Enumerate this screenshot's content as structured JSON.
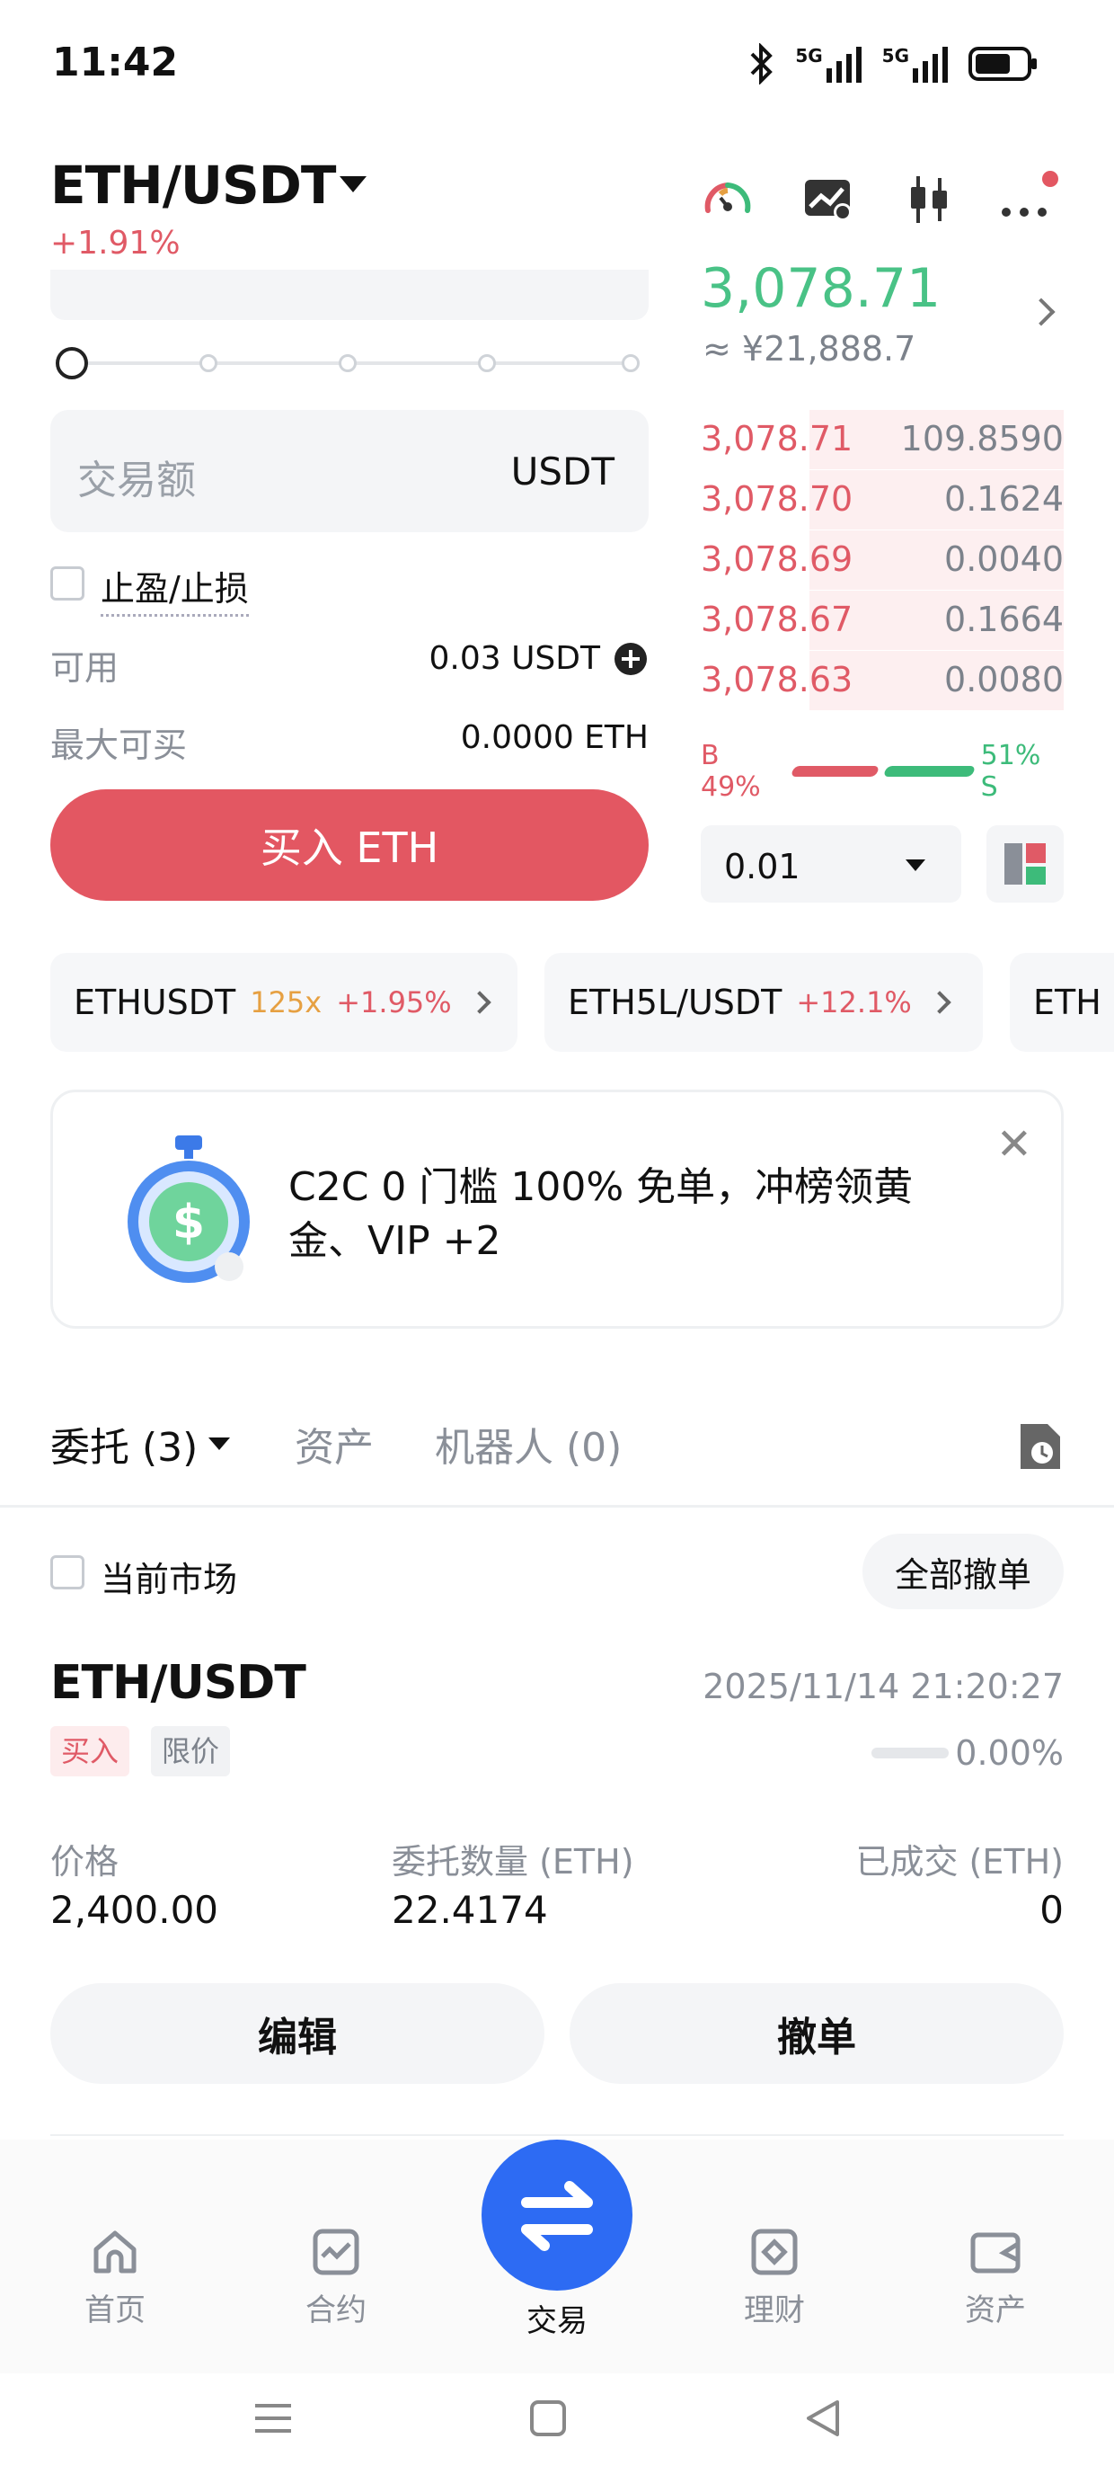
{
  "status_bar": {
    "time": "11:42",
    "network1": "5G",
    "network2": "5G"
  },
  "header": {
    "pair": "ETH/USDT",
    "change": "+1.91%"
  },
  "form": {
    "amount_placeholder": "交易额",
    "amount_unit": "USDT",
    "tp_sl_label": "止盈/止损",
    "available_label": "可用",
    "available_value": "0.03 USDT",
    "max_buy_label": "最大可买",
    "max_buy_value": "0.0000 ETH",
    "buy_button": "买入 ETH",
    "slider_value_pct": 0
  },
  "orderbook": {
    "last_price": "3,078.71",
    "last_price_cny": "≈ ¥21,888.7",
    "asks": [
      {
        "price": "3,078.71",
        "qty": "109.8590",
        "depth": 0.7
      },
      {
        "price": "3,078.70",
        "qty": "0.1624",
        "depth": 0.7
      },
      {
        "price": "3,078.69",
        "qty": "0.0040",
        "depth": 0.7
      },
      {
        "price": "3,078.67",
        "qty": "0.1664",
        "depth": 0.7
      },
      {
        "price": "3,078.63",
        "qty": "0.0080",
        "depth": 0.7
      }
    ],
    "buy_ratio_label": "B 49%",
    "sell_ratio_label": "51% S",
    "buy_ratio": 49,
    "sell_ratio": 51,
    "precision": "0.01"
  },
  "tickers": [
    {
      "symbol": "ETHUSDT",
      "leverage": "125x",
      "change": "+1.95%"
    },
    {
      "symbol": "ETH5L/USDT",
      "leverage": "",
      "change": "+12.1%"
    },
    {
      "symbol": "ETH",
      "leverage": "",
      "change": ""
    }
  ],
  "banner": {
    "text": "C2C 0 门槛 100% 免单，冲榜领黄金、VIP +2",
    "close": "✕"
  },
  "tabs": {
    "orders": "委托 (3)",
    "assets": "资产",
    "robots": "机器人 (0)"
  },
  "orders_panel": {
    "current_market": "当前市场",
    "cancel_all": "全部撤单",
    "order": {
      "pair": "ETH/USDT",
      "time": "2025/11/14 21:20:27",
      "side": "买入",
      "type": "限价",
      "filled_pct": "0.00%",
      "price_label": "价格",
      "price": "2,400.00",
      "qty_label": "委托数量 (ETH)",
      "qty": "22.4174",
      "filled_label": "已成交 (ETH)",
      "filled": "0",
      "edit": "编辑",
      "cancel": "撤单"
    }
  },
  "bottom_nav": {
    "home": "首页",
    "futures": "合约",
    "trade": "交易",
    "earn": "理财",
    "assets": "资产"
  },
  "colors": {
    "buy": "#e35762",
    "up": "#49c286",
    "brand": "#2d6bf3"
  }
}
